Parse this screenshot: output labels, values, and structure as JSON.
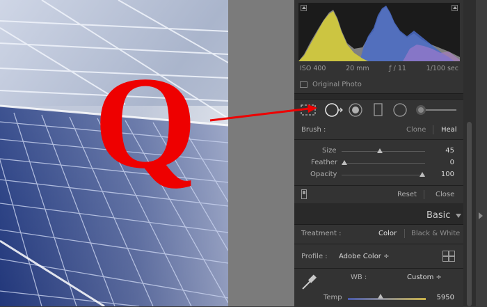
{
  "annotation": {
    "letter": "Q"
  },
  "histogram": {
    "iso": "ISO 400",
    "focal": "20 mm",
    "aperture": "ƒ / 11",
    "shutter": "1/100 sec",
    "original_photo": "Original Photo"
  },
  "tools": [
    "crop-overlay-icon",
    "spot-removal-icon",
    "red-eye-icon",
    "graduated-filter-icon",
    "radial-filter-icon",
    "adjustment-brush-icon"
  ],
  "spot_removal": {
    "brush_label": "Brush :",
    "clone": "Clone",
    "heal": "Heal",
    "sliders": [
      {
        "label": "Size",
        "value": "45",
        "fraction": 0.55
      },
      {
        "label": "Feather",
        "value": "0",
        "fraction": 0.03
      },
      {
        "label": "Opacity",
        "value": "100",
        "fraction": 1.0
      }
    ],
    "reset": "Reset",
    "close": "Close"
  },
  "basic": {
    "title": "Basic",
    "treatment_label": "Treatment :",
    "color": "Color",
    "bw": "Black & White",
    "profile_label": "Profile :",
    "profile_value": "Adobe Color ÷",
    "wb_label": "WB :",
    "wb_value": "Custom ÷",
    "temp_label": "Temp",
    "temp_value": "5950",
    "temp_fraction": 0.42
  },
  "colors": {
    "annotation": "#ee0000",
    "panel": "#292929",
    "section": "#333333"
  }
}
